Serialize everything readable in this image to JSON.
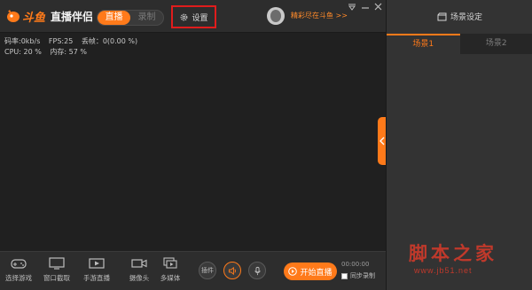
{
  "header": {
    "brand_logo": "斗鱼",
    "app_name": "直播伴侣",
    "mode_tabs": [
      {
        "label": "直播",
        "active": true
      },
      {
        "label": "录制",
        "active": false
      }
    ],
    "settings_label": "设置",
    "promo_text": "精彩尽在斗鱼 >>",
    "window_controls": [
      "dropdown-icon",
      "minimize-icon",
      "close-icon"
    ]
  },
  "stats": {
    "bitrate": "码率:0kb/s",
    "fps": "FPS:25",
    "dropped_frames": "丢帧：0(0.00 %)",
    "cpu": "CPU: 20 %",
    "memory": "内存: 57 %"
  },
  "toolbar": {
    "tools": [
      {
        "label": "选择游戏",
        "icon": "gamepad-icon"
      },
      {
        "label": "窗口截取",
        "icon": "monitor-icon"
      },
      {
        "label": "手游直播",
        "icon": "mobile-video-icon"
      },
      {
        "label": "摄像头",
        "icon": "camera-icon"
      },
      {
        "label": "多媒体",
        "icon": "media-icon"
      }
    ],
    "plugin_label": "插件",
    "start_label": "开始直播",
    "timer": "00:00:00",
    "sync_record_label": "同步录制",
    "sync_record_checked": false
  },
  "scene_panel": {
    "title": "场景设定",
    "tabs": [
      {
        "label": "场景1",
        "active": true
      },
      {
        "label": "场景2",
        "active": false
      }
    ]
  },
  "watermark": {
    "text": "脚本之家",
    "url": "www.jb51.net"
  },
  "colors": {
    "accent": "#ff7a1a",
    "highlight_border": "#e01c1c",
    "background": "#202020",
    "watermark": "#c0392b"
  }
}
